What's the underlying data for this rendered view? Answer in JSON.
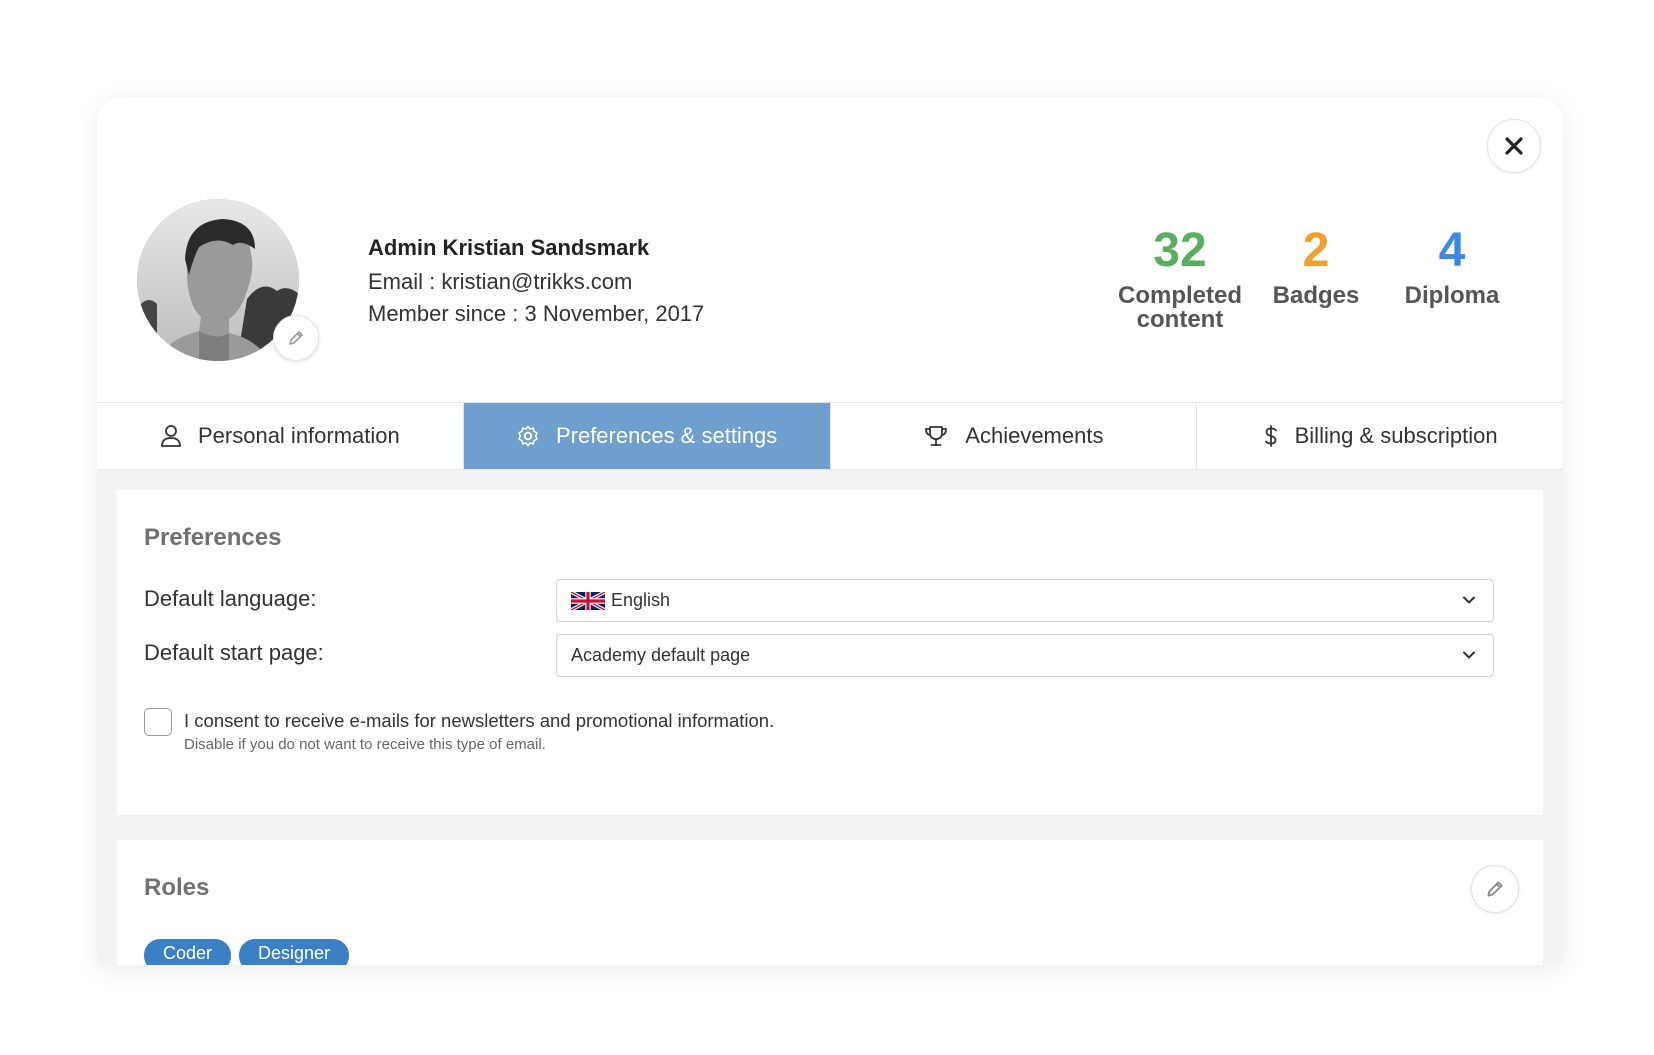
{
  "colors": {
    "accent": "#6e9fcf",
    "completed": "#5aae5f",
    "badges": "#f0a030",
    "diploma": "#3d88e6",
    "role_tag": "#3b7fc4"
  },
  "profile": {
    "name": "Admin Kristian Sandsmark",
    "email_line": "Email : kristian@trikks.com",
    "member_line": "Member since : 3 November, 2017",
    "avatar_icon": "user-photo",
    "avatar_edit_icon": "pencil-icon"
  },
  "stats": [
    {
      "value": "32",
      "label": "Completed content"
    },
    {
      "value": "2",
      "label": "Badges"
    },
    {
      "value": "4",
      "label": "Diploma"
    }
  ],
  "tabs": [
    {
      "label": "Personal information",
      "icon": "user-icon",
      "active": false
    },
    {
      "label": "Preferences & settings",
      "icon": "gear-icon",
      "active": true
    },
    {
      "label": "Achievements",
      "icon": "trophy-icon",
      "active": false
    },
    {
      "label": "Billing & subscription",
      "icon": "dollar-icon",
      "active": false
    }
  ],
  "preferences": {
    "title": "Preferences",
    "language_label": "Default language:",
    "language_value": "English",
    "language_flag_icon": "uk-flag-icon",
    "start_page_label": "Default start page:",
    "start_page_value": "Academy default page",
    "consent_text": "I consent to receive e-mails for newsletters and promotional information.",
    "consent_sub": "Disable if you do not want to receive this type of email.",
    "consent_checked": false
  },
  "roles": {
    "title": "Roles",
    "tags": [
      "Coder",
      "Designer"
    ]
  }
}
